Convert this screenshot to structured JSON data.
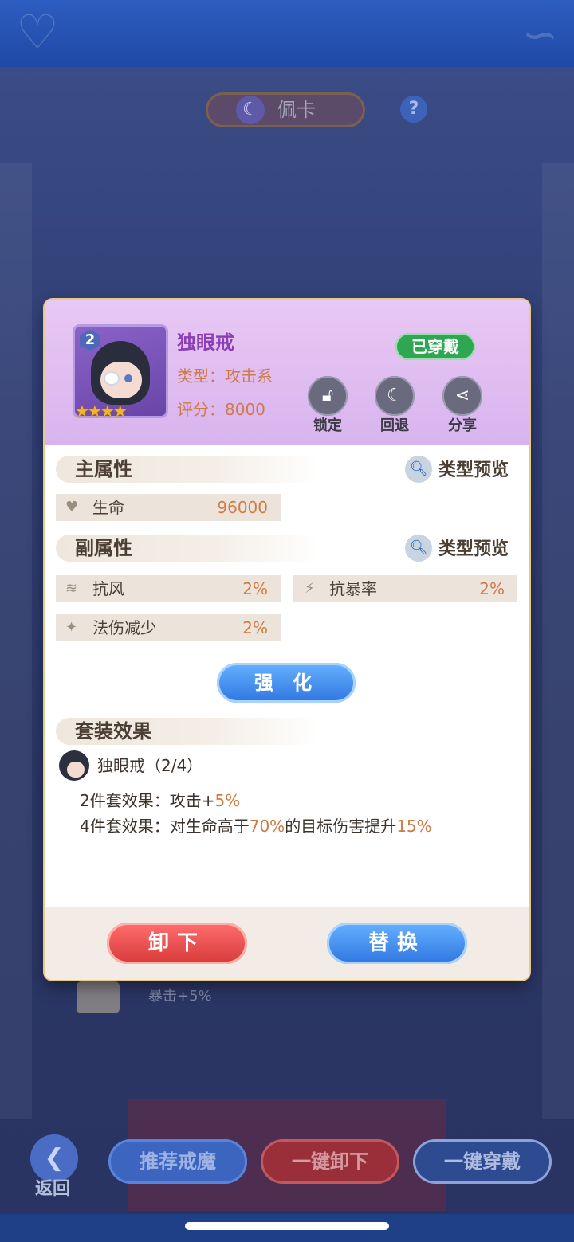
{
  "header": {
    "title": "佩卡",
    "icon": "crescent-icon",
    "help_icon": "?"
  },
  "background": {
    "faded_text": "暴击+5%"
  },
  "toolbar": {
    "back_label": "返回",
    "recommend_label": "推荐戒魔",
    "unequip_all_label": "一键卸下",
    "equip_all_label": "一键穿戴"
  },
  "item": {
    "level": "2",
    "stars": "★★★★",
    "name": "独眼戒",
    "type": "类型：攻击系",
    "score": "评分：8000",
    "equipped_badge": "已穿戴",
    "actions": {
      "lock": "锁定",
      "revert": "回退",
      "share": "分享"
    }
  },
  "main_attr": {
    "title": "主属性",
    "preview_label": "类型预览",
    "stats": [
      {
        "name": "生命",
        "value": "96000"
      }
    ]
  },
  "sub_attr": {
    "title": "副属性",
    "preview_label": "类型预览",
    "stats": [
      {
        "name": "抗风",
        "value": "2%"
      },
      {
        "name": "抗暴率",
        "value": "2%"
      },
      {
        "name": "法伤减少",
        "value": "2%"
      }
    ]
  },
  "enhance_label": "强 化",
  "set_effect": {
    "title": "套装效果",
    "set_name": "独眼戒（2/4）",
    "two_piece_prefix": "2件套效果：攻击+",
    "two_piece_value": "5%",
    "four_piece_prefix": "4件套效果：对生命高于",
    "four_piece_threshold": "70%",
    "four_piece_middle": "的目标伤害提升",
    "four_piece_value": "15%"
  },
  "footer": {
    "unequip_label": "卸下",
    "replace_label": "替换"
  },
  "colors": {
    "accent_orange": "#d07a45",
    "equipped_green": "#2ea652",
    "name_purple": "#8a3fb4"
  }
}
